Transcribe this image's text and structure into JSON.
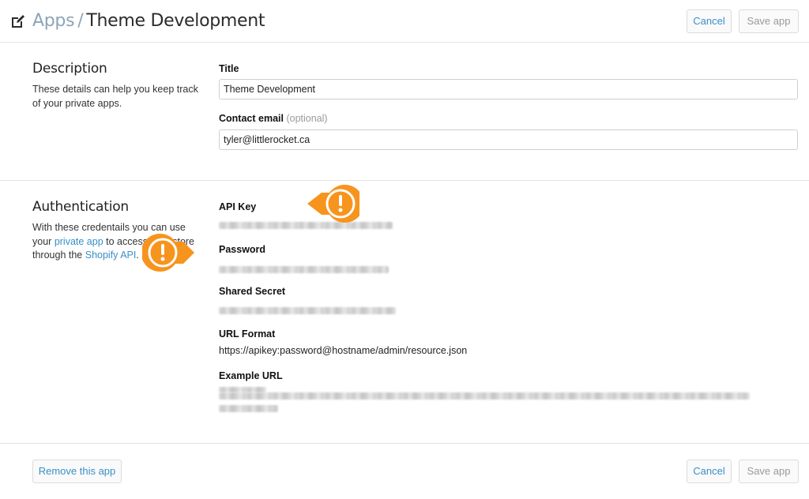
{
  "header": {
    "icon": "edit-icon",
    "breadcrumb_parent": "Apps",
    "breadcrumb_separator": "/",
    "breadcrumb_current": "Theme Development",
    "cancel_label": "Cancel",
    "save_label": "Save app"
  },
  "description": {
    "title": "Description",
    "text": "These details can help you keep track of your private apps.",
    "fields": {
      "title_label": "Title",
      "title_value": "Theme Development",
      "email_label": "Contact email",
      "email_optional": "(optional)",
      "email_value": "tyler@littlerocket.ca"
    }
  },
  "authentication": {
    "title": "Authentication",
    "text_before": "With these credentails you can use your",
    "link_private_app": "private app",
    "text_middle": "to access your store through the",
    "link_shopify_api": "Shopify API",
    "text_after": ".",
    "fields": {
      "api_key_label": "API Key",
      "password_label": "Password",
      "shared_secret_label": "Shared Secret",
      "url_format_label": "URL Format",
      "url_format_value": "https://apikey:password@hostname/admin/resource.json",
      "example_url_label": "Example URL"
    },
    "redacted_values": [
      "api_key",
      "password",
      "shared_secret",
      "example_url"
    ],
    "callout_icon": "exclamation-icon",
    "callout_color": "#f7941d"
  },
  "footer": {
    "remove_label": "Remove this app",
    "cancel_label": "Cancel",
    "save_label": "Save app"
  },
  "colors": {
    "link": "#3a8fc9",
    "breadcrumb_muted": "#8ea4b8",
    "callout": "#f7941d"
  }
}
